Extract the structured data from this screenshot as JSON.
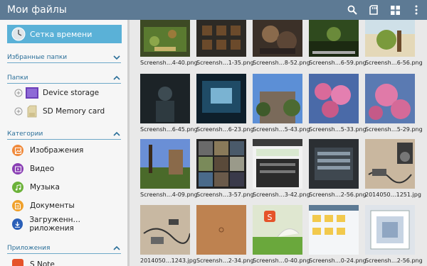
{
  "app": {
    "title": "Мои файлы"
  },
  "sidebar": {
    "timeline_label": "Сетка времени",
    "favorites_label": "Избранные папки",
    "folders_label": "Папки",
    "folders": [
      {
        "label": "Device storage"
      },
      {
        "label": "SD Memory card"
      }
    ],
    "categories_label": "Категории",
    "categories": [
      {
        "label": "Изображения",
        "color": "#f08a3c"
      },
      {
        "label": "Видео",
        "color": "#8a3fb4"
      },
      {
        "label": "Музыка",
        "color": "#6cb23a"
      },
      {
        "label": "Документы",
        "color": "#f0a12c"
      },
      {
        "label": "Загруженн…риложения",
        "color": "#2a5fb8"
      }
    ],
    "apps_label": "Приложения",
    "apps": [
      {
        "label": "S Note",
        "color": "#e5532a"
      }
    ]
  },
  "files": [
    {
      "name": "Screensh…4-40.png"
    },
    {
      "name": "Screensh…1-35.png"
    },
    {
      "name": "Screensh…8-52.png"
    },
    {
      "name": "Screensh…6-59.png"
    },
    {
      "name": "Screensh…6-56.png"
    },
    {
      "name": "Screensh…6-45.png"
    },
    {
      "name": "Screensh…6-23.png"
    },
    {
      "name": "Screensh…5-43.png"
    },
    {
      "name": "Screensh…5-33.png"
    },
    {
      "name": "Screensh…5-29.png"
    },
    {
      "name": "Screensh…4-09.png"
    },
    {
      "name": "Screensh…3-57.png"
    },
    {
      "name": "Screensh…3-42.png"
    },
    {
      "name": "Screensh…2-56.png"
    },
    {
      "name": "2014050…1251.jpg"
    },
    {
      "name": "2014050…1243.jpg"
    },
    {
      "name": "Screensh…2-34.png"
    },
    {
      "name": "Screensh…0-40.png"
    },
    {
      "name": "Screensh…0-24.png"
    },
    {
      "name": "Screensh…2-56.png"
    }
  ]
}
